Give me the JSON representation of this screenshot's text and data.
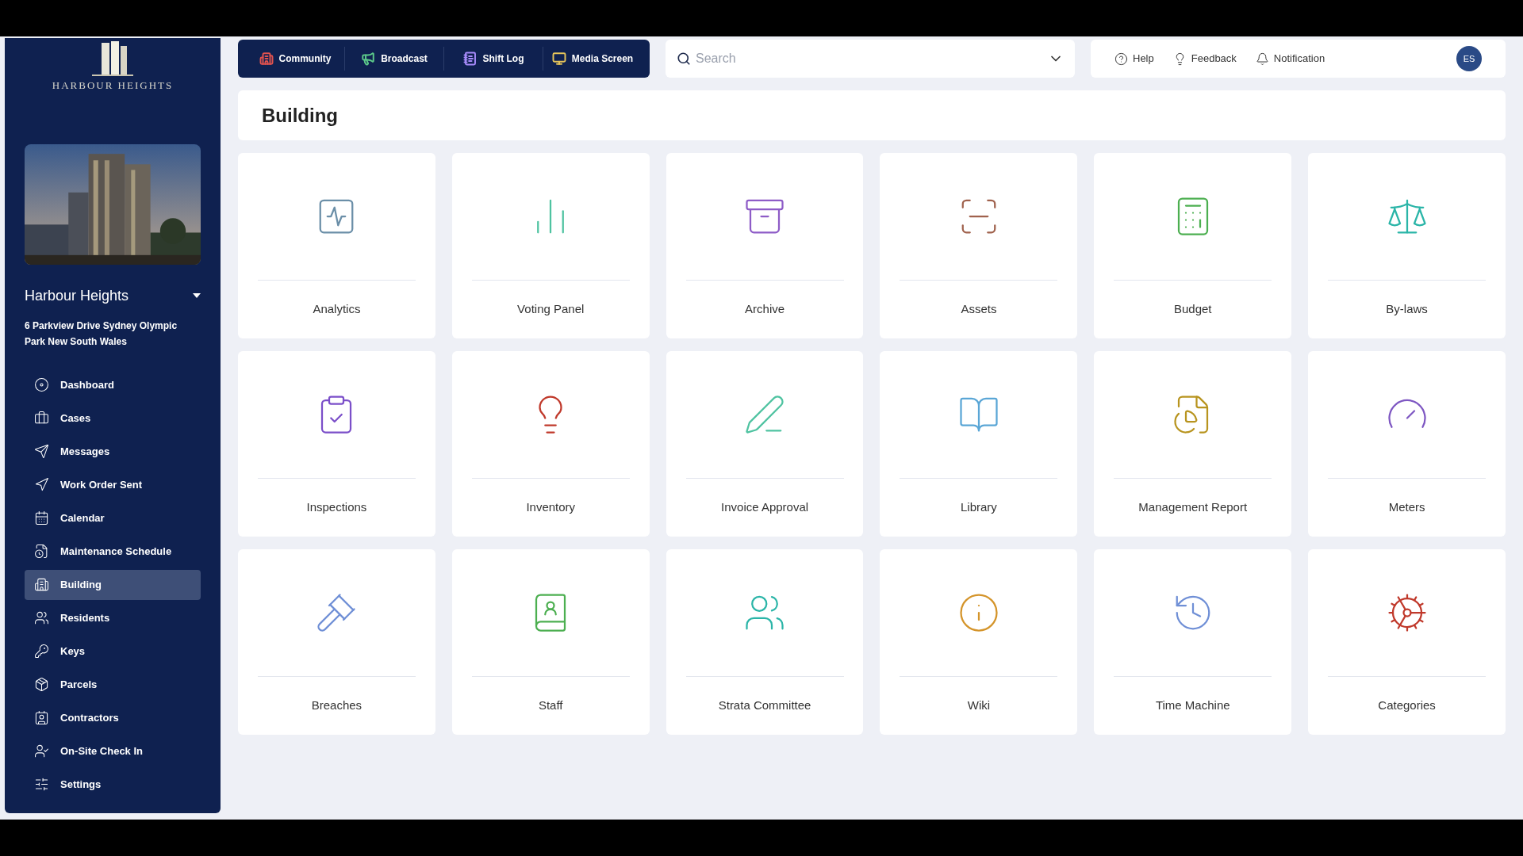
{
  "sidebar": {
    "logo_text": "HARBOUR HEIGHTS",
    "property_name": "Harbour Heights",
    "address": "6 Parkview Drive Sydney Olympic Park New South Wales",
    "items": [
      {
        "label": "Dashboard",
        "selected": false
      },
      {
        "label": "Cases",
        "selected": false
      },
      {
        "label": "Messages",
        "selected": false
      },
      {
        "label": "Work Order Sent",
        "selected": false
      },
      {
        "label": "Calendar",
        "selected": false
      },
      {
        "label": "Maintenance Schedule",
        "selected": false
      },
      {
        "label": "Building",
        "selected": true
      },
      {
        "label": "Residents",
        "selected": false
      },
      {
        "label": "Keys",
        "selected": false
      },
      {
        "label": "Parcels",
        "selected": false
      },
      {
        "label": "Contractors",
        "selected": false
      },
      {
        "label": "On-Site Check In",
        "selected": false
      },
      {
        "label": "Settings",
        "selected": false
      }
    ]
  },
  "top_tabs": [
    {
      "label": "Community",
      "color": "#e0524f"
    },
    {
      "label": "Broadcast",
      "color": "#5cc98a"
    },
    {
      "label": "Shift Log",
      "color": "#a78bfa"
    },
    {
      "label": "Media Screen",
      "color": "#e5c45a"
    }
  ],
  "search": {
    "placeholder": "Search"
  },
  "header_links": [
    "Help",
    "Feedback",
    "Notification"
  ],
  "avatar": "ES",
  "page_title": "Building",
  "tiles": [
    {
      "label": "Analytics",
      "color": "#6b8fa8"
    },
    {
      "label": "Voting Panel",
      "color": "#4fc3a1"
    },
    {
      "label": "Archive",
      "color": "#8e5cc7"
    },
    {
      "label": "Assets",
      "color": "#a0624d"
    },
    {
      "label": "Budget",
      "color": "#4caf50"
    },
    {
      "label": "By-laws",
      "color": "#2bb5a8"
    },
    {
      "label": "Inspections",
      "color": "#7b4fc9"
    },
    {
      "label": "Inventory",
      "color": "#c0392b"
    },
    {
      "label": "Invoice Approval",
      "color": "#4fc3a1"
    },
    {
      "label": "Library",
      "color": "#5aa6d6"
    },
    {
      "label": "Management Report",
      "color": "#b8941f"
    },
    {
      "label": "Meters",
      "color": "#7e57c2"
    },
    {
      "label": "Breaches",
      "color": "#6f8fd6"
    },
    {
      "label": "Staff",
      "color": "#4caf50"
    },
    {
      "label": "Strata Committee",
      "color": "#2bb5a8"
    },
    {
      "label": "Wiki",
      "color": "#d4942a"
    },
    {
      "label": "Time Machine",
      "color": "#6f8fd6"
    },
    {
      "label": "Categories",
      "color": "#c0392b"
    }
  ]
}
